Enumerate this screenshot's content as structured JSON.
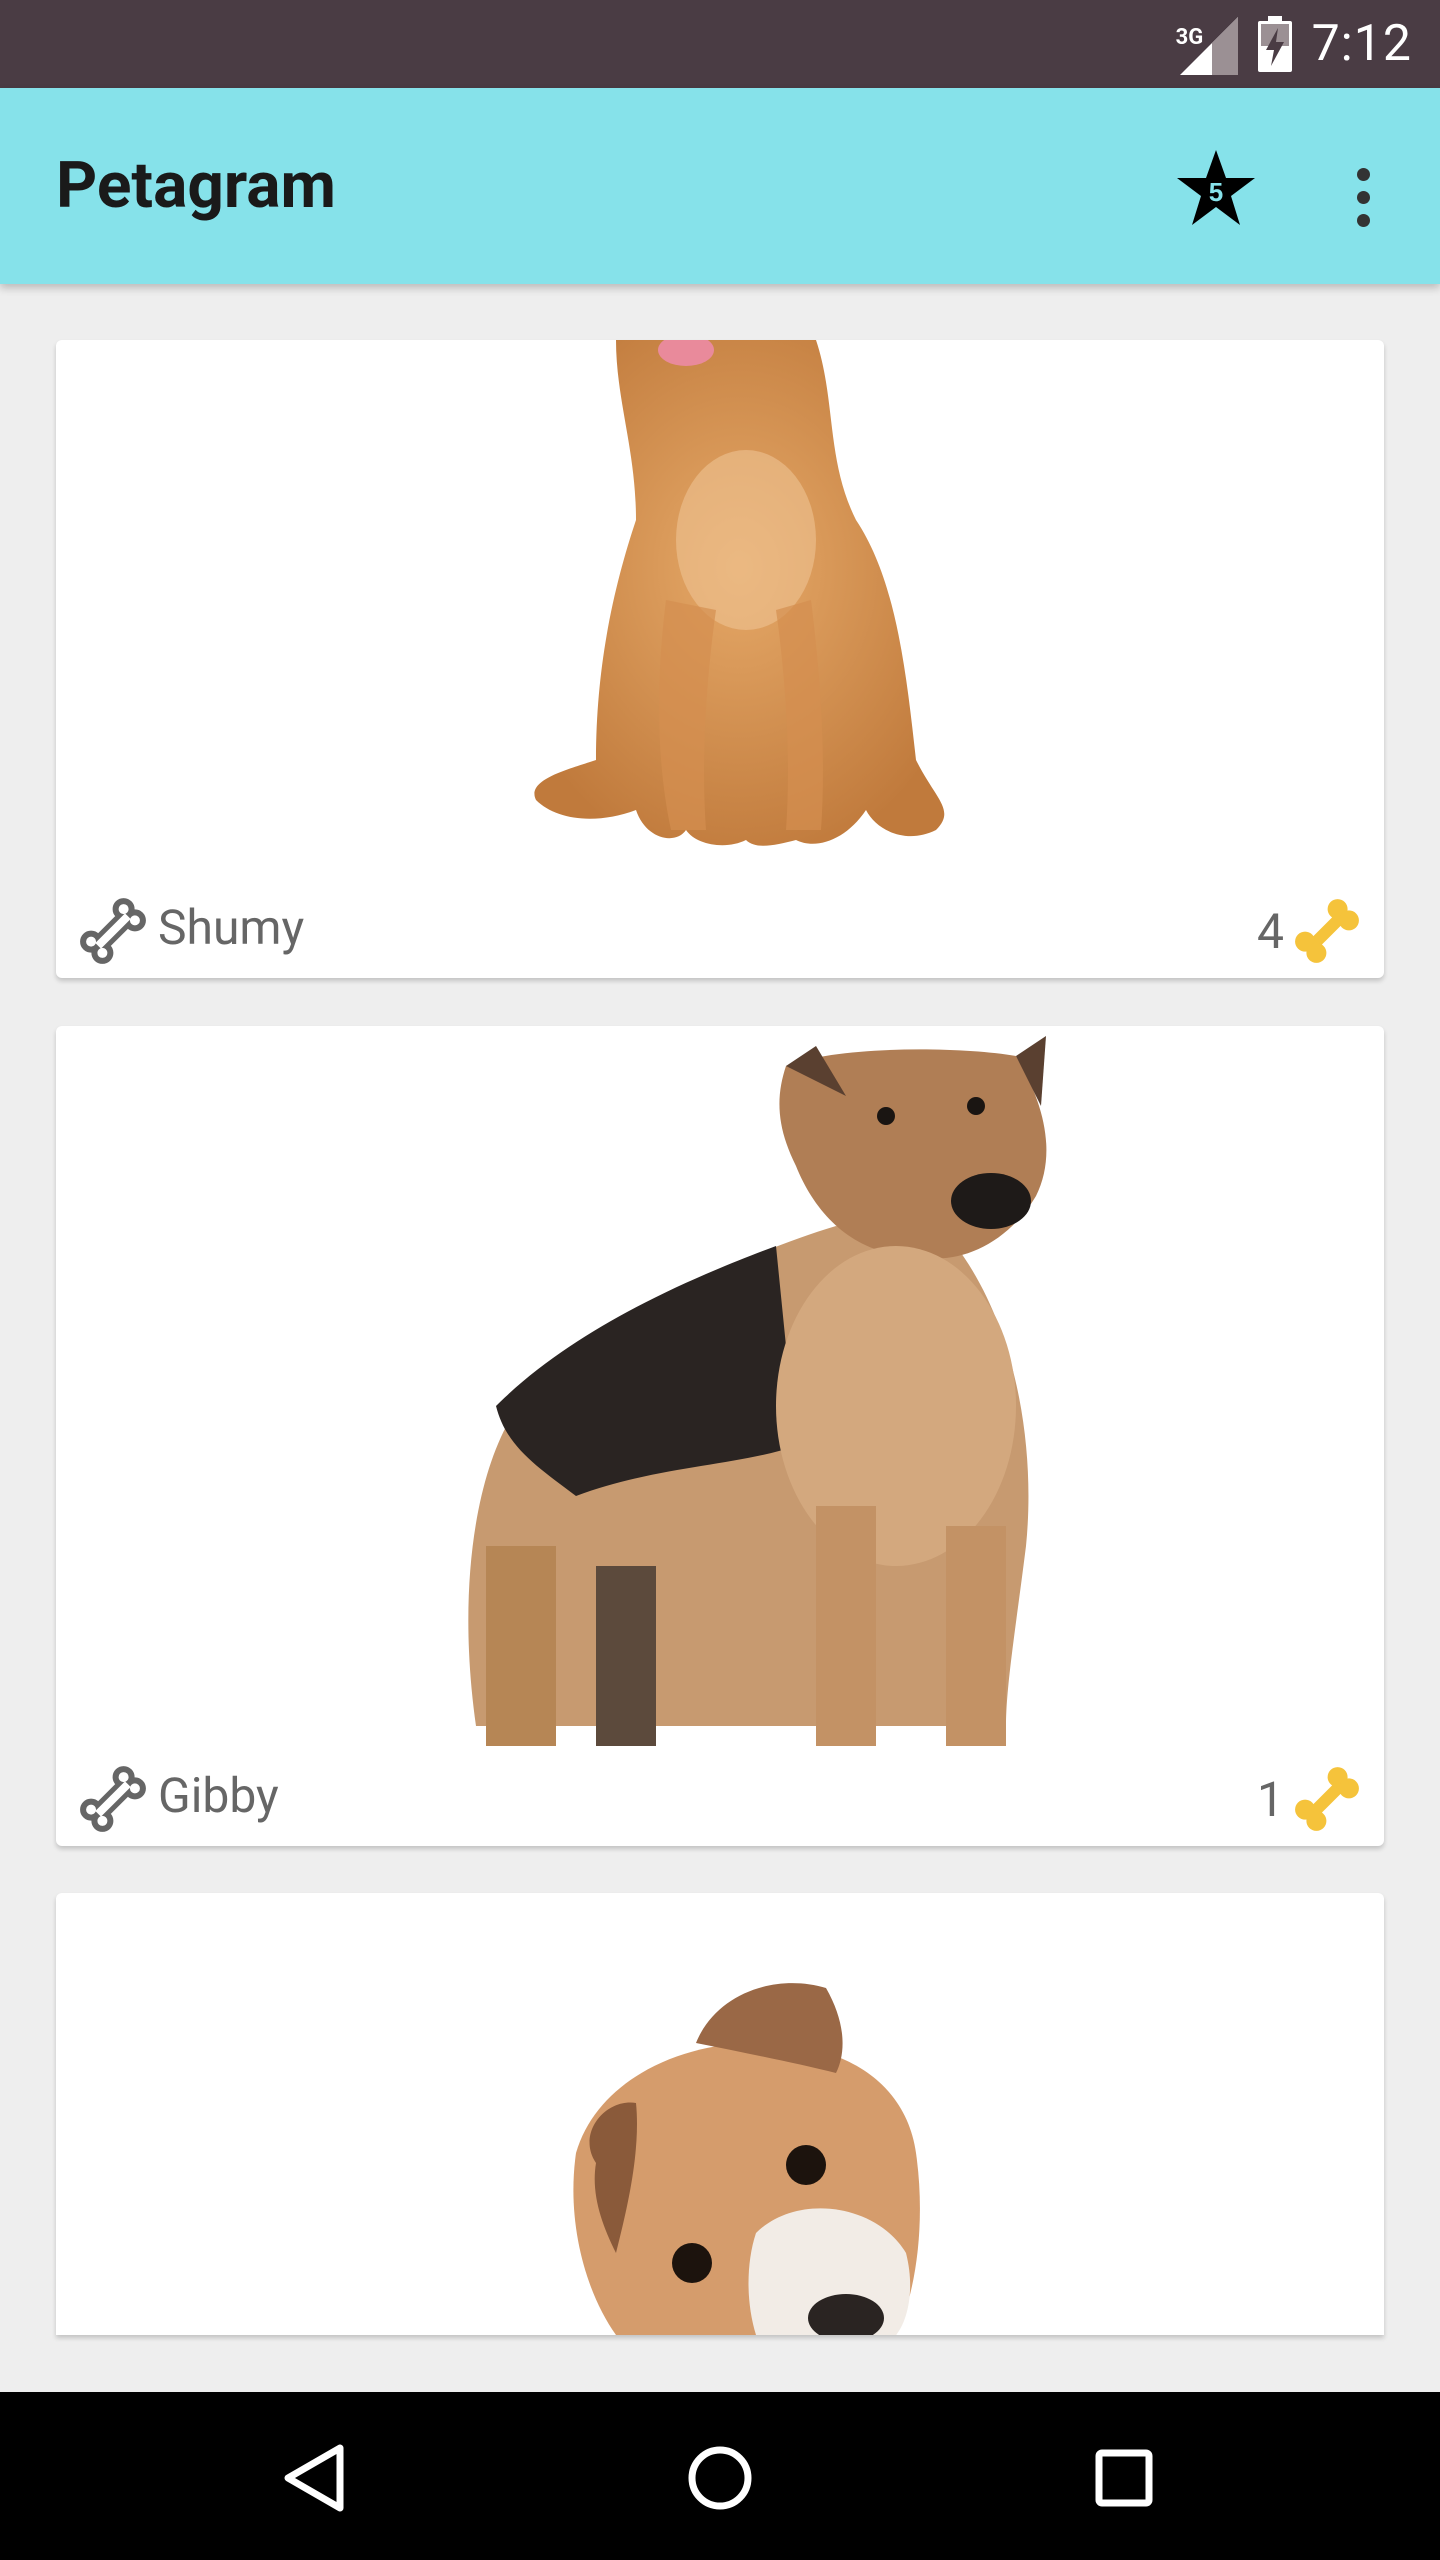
{
  "status_bar": {
    "network": "3G",
    "time": "7:12"
  },
  "app_bar": {
    "title": "Petagram",
    "favorites_count": "5",
    "favorites_icon": "star-icon",
    "menu_icon": "more-vert-icon"
  },
  "pets": [
    {
      "name": "Shumy",
      "likes": "4",
      "image": "golden-retriever-photo"
    },
    {
      "name": "Gibby",
      "likes": "1",
      "image": "german-shepherd-photo"
    },
    {
      "image": "jack-russell-terrier-photo"
    }
  ],
  "nav_bar": {
    "back_icon": "back-triangle-icon",
    "home_icon": "home-circle-icon",
    "recents_icon": "recents-square-icon"
  },
  "colors": {
    "app_bar": "#86e2ea",
    "status_bar": "#4a3c44",
    "bone_gold": "#f5c33b"
  }
}
